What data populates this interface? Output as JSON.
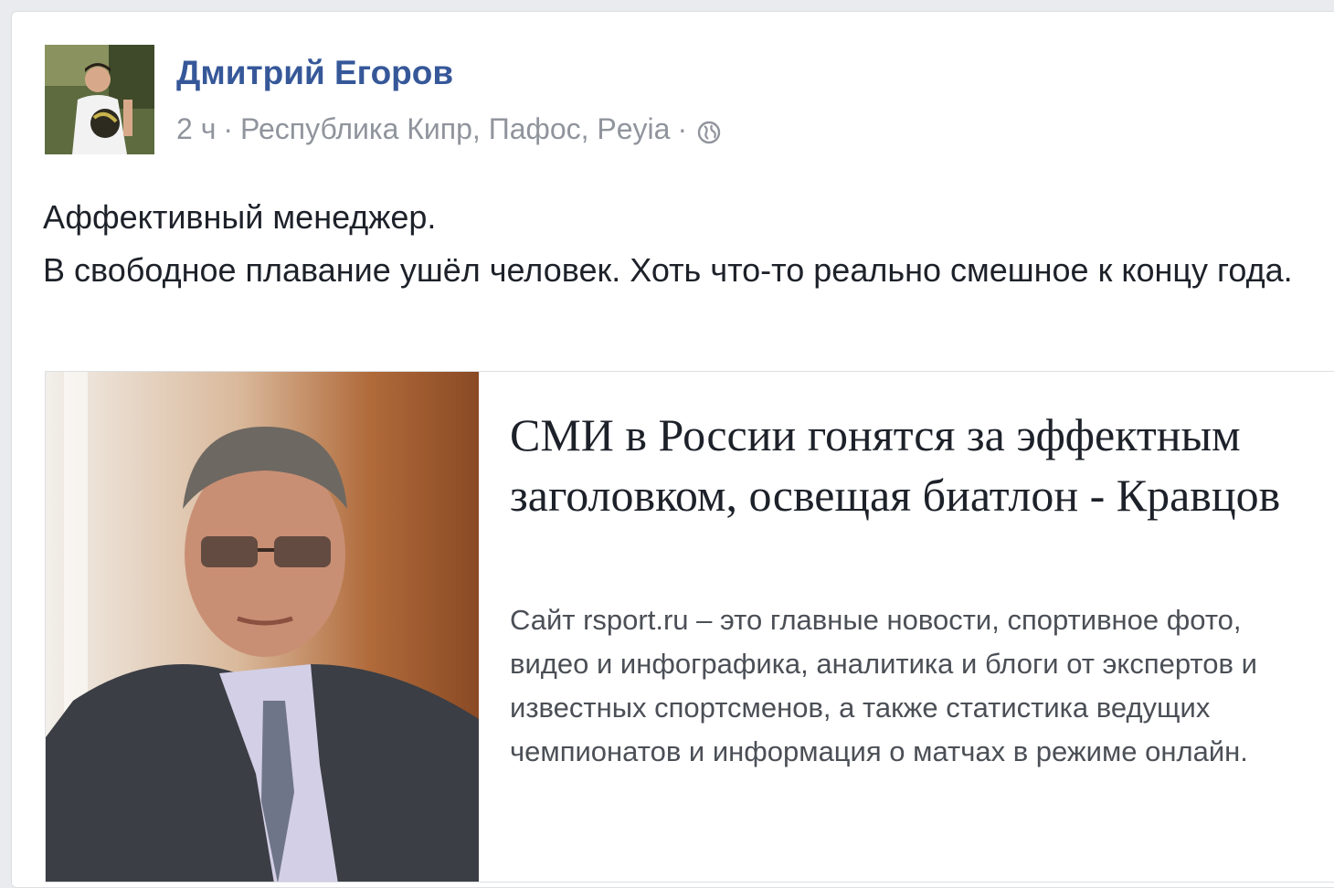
{
  "post": {
    "author": "Дмитрий Егоров",
    "time": "2 ч",
    "separator": "·",
    "location": "Республика Кипр, Пафос, Peyia",
    "privacy_icon": "globe-icon",
    "text_lines": [
      "Аффективный менеджер.",
      "В свободное плавание ушёл человек. Хоть что-то реально смешное к концу года."
    ]
  },
  "link_preview": {
    "title": "СМИ в России гонятся за эффектным заголовком, освещая биатлон - Кравцов",
    "description": "Сайт rsport.ru – это главные новости, спортивное фото, видео и инфографика, аналитика и блоги от экспертов и известных спортсменов, а также статистика ведущих чемпионатов и информация о матчах в режиме онлайн."
  },
  "colors": {
    "author_link": "#365899",
    "meta_text": "#90949c",
    "body_text": "#1d2129",
    "page_background": "#e9ebee"
  }
}
